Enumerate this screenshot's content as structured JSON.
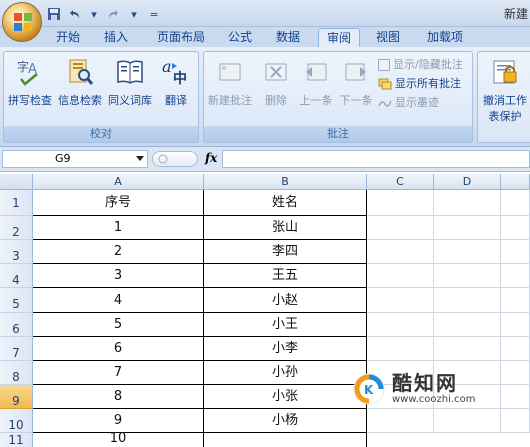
{
  "window": {
    "title": "新建"
  },
  "tabs": [
    "开始",
    "插入",
    "页面布局",
    "公式",
    "数据",
    "审阅",
    "视图",
    "加载项"
  ],
  "ribbon": {
    "proofing": {
      "label": "校对",
      "buttons": [
        "拼写检查",
        "信息检索",
        "同义词库",
        "翻译"
      ]
    },
    "comments": {
      "label": "批注",
      "buttons": [
        "新建批注",
        "删除",
        "上一条",
        "下一条"
      ],
      "toggles": [
        "显示/隐藏批注",
        "显示所有批注",
        "显示墨迹"
      ]
    },
    "changes": {
      "button_line1": "撤消工作",
      "button_line2": "表保护"
    }
  },
  "formula_bar": {
    "name_box": "G9",
    "fx": "fx",
    "value": ""
  },
  "sheet": {
    "columns": [
      "A",
      "B",
      "C",
      "D"
    ],
    "rows": [
      "1",
      "2",
      "3",
      "4",
      "5",
      "6",
      "7",
      "8",
      "9",
      "10",
      "11"
    ],
    "selected_row": "9",
    "data": [
      [
        "序号",
        "姓名"
      ],
      [
        "1",
        "张山"
      ],
      [
        "2",
        "李四"
      ],
      [
        "3",
        "王五"
      ],
      [
        "4",
        "小赵"
      ],
      [
        "5",
        "小王"
      ],
      [
        "6",
        "小李"
      ],
      [
        "7",
        "小孙"
      ],
      [
        "8",
        "小张"
      ],
      [
        "9",
        "小杨"
      ],
      [
        "10",
        ""
      ]
    ]
  },
  "watermark": {
    "name": "酷知网",
    "url": "www.coozhi.com"
  },
  "icons": {
    "office": "office-logo-icon",
    "save": "save-icon",
    "undo": "undo-icon",
    "redo": "redo-icon"
  }
}
